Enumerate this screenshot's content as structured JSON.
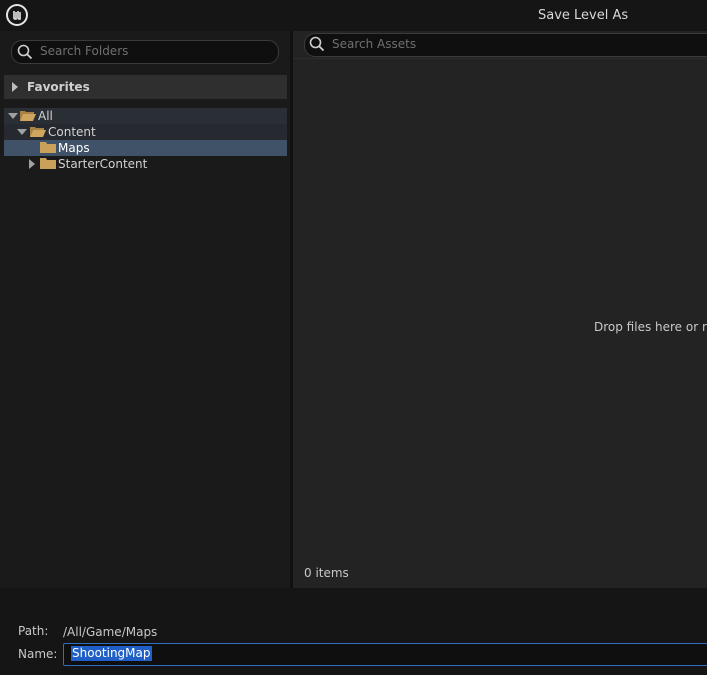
{
  "window": {
    "title": "Save Level As"
  },
  "folder_search": {
    "placeholder": "Search Folders"
  },
  "favorites": {
    "label": "Favorites"
  },
  "tree": {
    "items": [
      {
        "label": "All",
        "expanded": true,
        "selected": false
      },
      {
        "label": "Content",
        "expanded": true,
        "selected": false
      },
      {
        "label": "Maps",
        "expanded": false,
        "selected": true
      },
      {
        "label": "StarterContent",
        "expanded": false,
        "selected": false
      }
    ]
  },
  "asset_search": {
    "placeholder": "Search Assets"
  },
  "asset_view": {
    "drop_hint": "Drop files here or ri",
    "items_count": "0 items"
  },
  "footer": {
    "path_label": "Path:",
    "path_value": "/All/Game/Maps",
    "name_label": "Name:",
    "name_value": "ShootingMap"
  },
  "colors": {
    "selection": "#3f5268",
    "accent_focus": "#2f6fbd",
    "folder": "#c9a15a"
  },
  "icons": [
    "unreal-logo-icon",
    "search-icon",
    "folder-icon",
    "folder-open-icon",
    "chevron-right-icon",
    "chevron-down-icon"
  ]
}
